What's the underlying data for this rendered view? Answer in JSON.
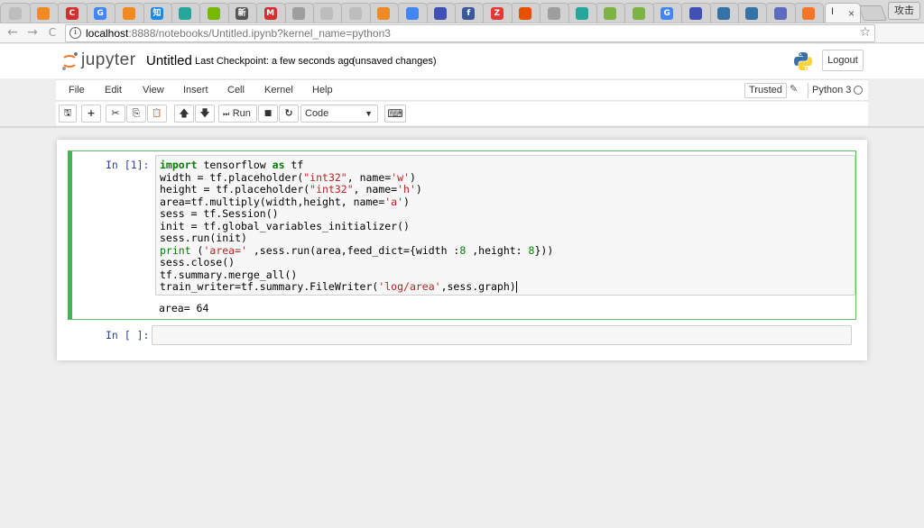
{
  "browser": {
    "active_tab": {
      "title": "I",
      "close": "×"
    },
    "profile_label": "攻击",
    "url": {
      "host": "localhost",
      "rest": ":8888/notebooks/Untitled.ipynb?kernel_name=python3"
    },
    "back_glyph": "←",
    "forward_glyph": "→",
    "reload_glyph": "C",
    "info_glyph": "i",
    "star_glyph": "☆",
    "menu_glyph": "⋮",
    "tabs": [
      {
        "label": "",
        "color": "#bdbdbd"
      },
      {
        "label": "",
        "color": "#f08a24"
      },
      {
        "label": "C",
        "color": "#d32f2f"
      },
      {
        "label": "G",
        "color": "#4285f4"
      },
      {
        "label": "",
        "color": "#f08a24"
      },
      {
        "label": "知",
        "color": "#1e88e5"
      },
      {
        "label": "",
        "color": "#26a69a"
      },
      {
        "label": "",
        "color": "#76b900"
      },
      {
        "label": "新",
        "color": "#555555"
      },
      {
        "label": "M",
        "color": "#d32f2f"
      },
      {
        "label": "",
        "color": "#9e9e9e"
      },
      {
        "label": "",
        "color": "#bdbdbd"
      },
      {
        "label": "",
        "color": "#bdbdbd"
      },
      {
        "label": "",
        "color": "#f08a24"
      },
      {
        "label": "",
        "color": "#4285f4"
      },
      {
        "label": "",
        "color": "#3f51b5"
      },
      {
        "label": "f",
        "color": "#3b5998"
      },
      {
        "label": "Z",
        "color": "#e53935"
      },
      {
        "label": "",
        "color": "#e65100"
      },
      {
        "label": "",
        "color": "#9e9e9e"
      },
      {
        "label": "",
        "color": "#26a69a"
      },
      {
        "label": "",
        "color": "#7cb342"
      },
      {
        "label": "",
        "color": "#7cb342"
      },
      {
        "label": "G",
        "color": "#4285f4"
      },
      {
        "label": "",
        "color": "#3f51b5"
      },
      {
        "label": "",
        "color": "#3572a5"
      },
      {
        "label": "",
        "color": "#3572a5"
      },
      {
        "label": "",
        "color": "#5c6bc0"
      },
      {
        "label": "",
        "color": "#f37726"
      }
    ]
  },
  "jupyter": {
    "logo_text": "jupyter",
    "notebook_title": "Untitled",
    "checkpoint": "Last Checkpoint: a few seconds ago",
    "autosave_status": "(unsaved changes)",
    "logout_label": "Logout",
    "menu": [
      "File",
      "Edit",
      "View",
      "Insert",
      "Cell",
      "Kernel",
      "Help"
    ],
    "trusted_label": "Trusted",
    "kernel_name": "Python 3",
    "pencil_glyph": "✎",
    "toolbar": {
      "save_glyph": "🖫",
      "add_glyph": "+",
      "cut_glyph": "✂",
      "copy_glyph": "⎘",
      "paste_glyph": "📋",
      "up_glyph": "🡅",
      "down_glyph": "🡇",
      "run_label": "Run",
      "run_glyph": "⏭",
      "stop_glyph": "■",
      "restart_glyph": "↻",
      "cell_type": "Code",
      "caret_glyph": "▼",
      "keyboard_glyph": "⌨"
    },
    "cells": [
      {
        "prompt": "In [1]:",
        "code": [
          "import tensorflow as tf",
          "width = tf.placeholder(\"int32\", name='w')",
          "height = tf.placeholder(\"int32\", name='h')",
          "area=tf.multiply(width,height, name='a')",
          "sess = tf.Session()",
          "init = tf.global_variables_initializer()",
          "sess.run(init)",
          "print ('area=' ,sess.run(area,feed_dict={width :8 ,height: 8}))",
          "sess.close()",
          "tf.summary.merge_all()",
          "train_writer=tf.summary.FileWriter('log/area',sess.graph)"
        ],
        "output": "area= 64"
      },
      {
        "prompt": "In [ ]:",
        "code": []
      }
    ]
  }
}
